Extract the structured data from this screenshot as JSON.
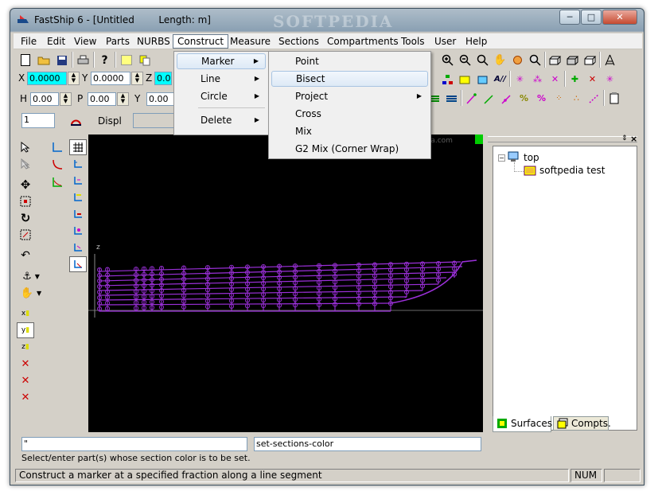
{
  "window": {
    "title": "FastShip 6 - [Untitled        Length: m]",
    "watermark": "SOFTPEDIA",
    "watermark_url": "www.softpedia.com",
    "caption_minimize": "─",
    "caption_maximize": "□",
    "caption_close": "✕"
  },
  "menubar": [
    "File",
    "Edit",
    "View",
    "Parts",
    "NURBS",
    "Construct",
    "Measure",
    "Sections",
    "Compartments",
    "Tools",
    "User",
    "Help"
  ],
  "construct_menu": [
    {
      "label": "Marker",
      "has_sub": true
    },
    {
      "label": "Line",
      "has_sub": true
    },
    {
      "label": "Circle",
      "has_sub": true
    },
    {
      "label": "Delete",
      "has_sub": true
    }
  ],
  "marker_submenu": [
    {
      "label": "Point"
    },
    {
      "label": "Bisect"
    },
    {
      "label": "Project",
      "has_sub": true
    },
    {
      "label": "Cross"
    },
    {
      "label": "Mix"
    },
    {
      "label": "G2 Mix (Corner Wrap)"
    }
  ],
  "toolbar2": {
    "x_label": "X",
    "x_value": "0.0000",
    "y_label": "Y",
    "y_value": "0.0000",
    "z_label": "Z",
    "z_value": "0.0"
  },
  "toolbar3": {
    "h_label": "H",
    "h_value": "0.00",
    "p_label": "P",
    "p_value": "0.00",
    "y_label": "Y",
    "y_value": "0.00"
  },
  "toolbar4": {
    "layer_value": "1",
    "displ_label": "Displ"
  },
  "canvas": {
    "axis_label": "z"
  },
  "tree": {
    "root": "top",
    "child": "softpedia test",
    "tabs": [
      "Surfaces",
      "Compts."
    ]
  },
  "command": {
    "input_value": "\"",
    "command_name": "set-sections-color",
    "prompt": "Select/enter part(s) whose section color is to be set."
  },
  "status": {
    "message": "Construct a marker at a specified fraction along a line segment",
    "num": "NUM"
  },
  "colors": {
    "hull": "#9b30d9",
    "canvas": "#000000",
    "field_highlight": "#00ffff"
  }
}
